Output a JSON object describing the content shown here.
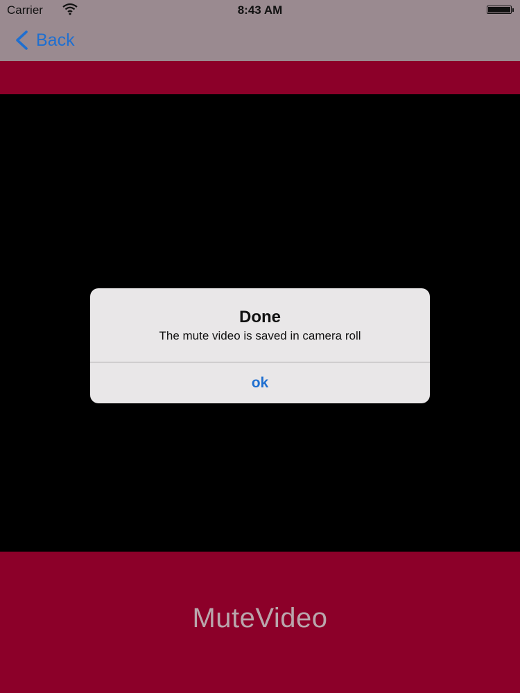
{
  "status_bar": {
    "carrier": "Carrier",
    "time": "8:43 AM",
    "wifi_icon": "wifi-icon",
    "battery_icon": "battery-icon"
  },
  "nav": {
    "back_label": "Back",
    "back_icon": "chevron-left-icon"
  },
  "alert": {
    "title": "Done",
    "message": "The mute video is saved in camera roll",
    "ok_label": "ok"
  },
  "footer": {
    "app_title": "MuteVideo"
  },
  "colors": {
    "accent": "#1f6fd0",
    "brand": "#8c0029",
    "nav_background": "#9a8a90",
    "video_background": "#000000",
    "alert_background": "#e9e7e8"
  }
}
